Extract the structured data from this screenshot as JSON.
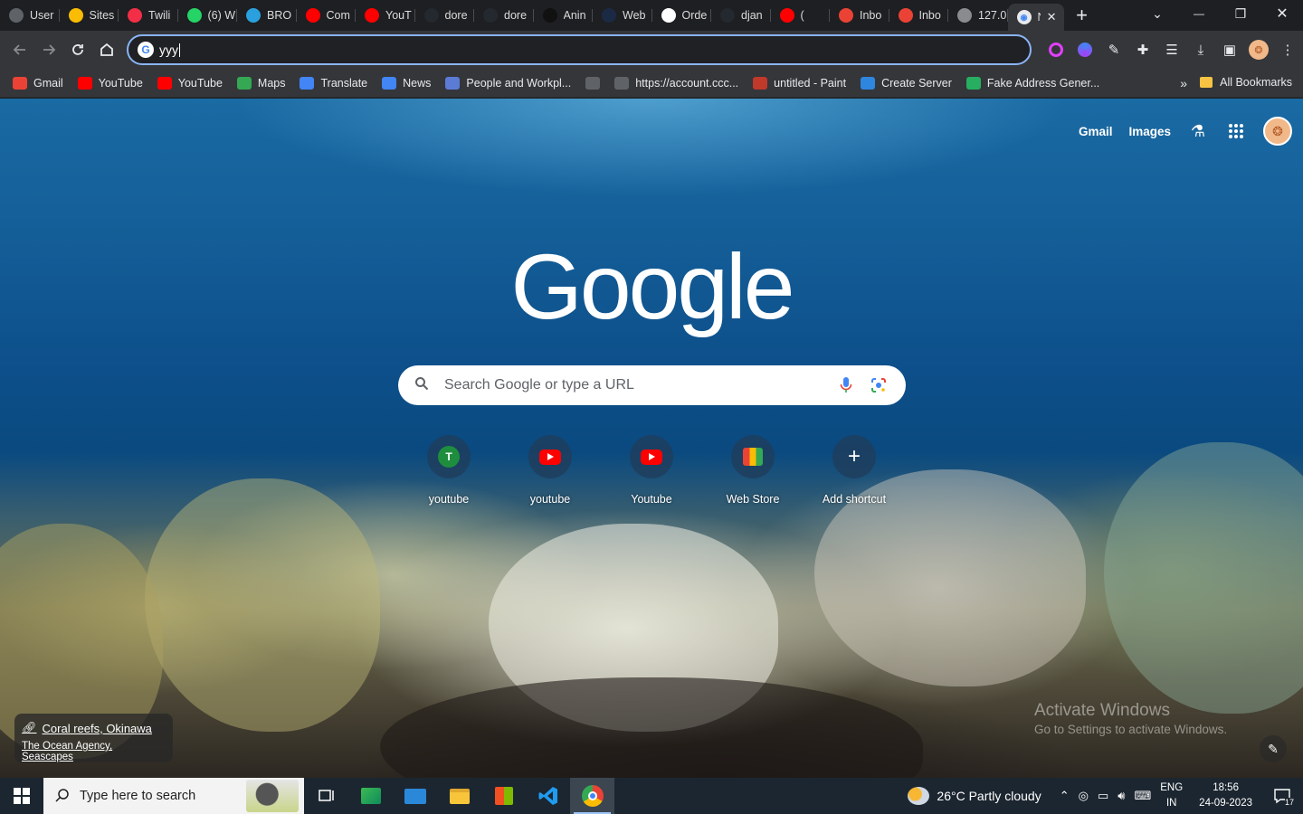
{
  "tabs": [
    {
      "title": "User",
      "icon": "openai-icon",
      "color": "#5f6368"
    },
    {
      "title": "Sites",
      "icon": "google-ads-icon",
      "color": "#fbbc04"
    },
    {
      "title": "Twili",
      "icon": "twilio-icon",
      "color": "#f22f46"
    },
    {
      "title": "(6) W",
      "icon": "whatsapp-icon",
      "color": "#25d366"
    },
    {
      "title": "BRO",
      "icon": "telegram-icon",
      "color": "#2aa1de"
    },
    {
      "title": "Com",
      "icon": "youtube-icon",
      "color": "#ff0000"
    },
    {
      "title": "YouT",
      "icon": "youtube-icon",
      "color": "#ff0000"
    },
    {
      "title": "dore",
      "icon": "github-icon",
      "color": "#24292f"
    },
    {
      "title": "dore",
      "icon": "github-icon",
      "color": "#24292f"
    },
    {
      "title": "Anin",
      "icon": "amazon-icon",
      "color": "#111111"
    },
    {
      "title": "Web",
      "icon": "webflow-icon",
      "color": "#1b2a44"
    },
    {
      "title": "Orde",
      "icon": "store-icon",
      "color": "#ffffff"
    },
    {
      "title": "djan",
      "icon": "github-icon",
      "color": "#24292f"
    },
    {
      "title": "(",
      "icon": "youtube-icon",
      "color": "#ff0000"
    },
    {
      "title": "Inbo",
      "icon": "gmail-icon",
      "color": "#ea4335"
    },
    {
      "title": "Inbo",
      "icon": "gmail-icon",
      "color": "#ea4335"
    },
    {
      "title": "127.0",
      "icon": "globe-icon",
      "color": "#8a8b8f"
    }
  ],
  "active_tab": {
    "title": "N",
    "icon": "chrome-icon",
    "close": "✕"
  },
  "new_tab_symbol": "+",
  "window_controls": {
    "tab_search": "⌄",
    "minimize": "—",
    "restore": "❐",
    "close": "✕"
  },
  "omnibox": {
    "favicon": "G",
    "value": "yyy"
  },
  "bookmarks": [
    {
      "label": "Gmail",
      "icon": "gmail-icon",
      "color": "#ea4335"
    },
    {
      "label": "YouTube",
      "icon": "youtube-icon",
      "color": "#ff0000"
    },
    {
      "label": "YouTube",
      "icon": "youtube-icon",
      "color": "#ff0000"
    },
    {
      "label": "Maps",
      "icon": "maps-icon",
      "color": "#34a853"
    },
    {
      "label": "Translate",
      "icon": "translate-icon",
      "color": "#4285f4"
    },
    {
      "label": "News",
      "icon": "news-icon",
      "color": "#4285f4"
    },
    {
      "label": "People and Workpl...",
      "icon": "shield-icon",
      "color": "#5b7bd5"
    },
    {
      "label": "",
      "icon": "globe-icon",
      "color": "#5f6368"
    },
    {
      "label": "https://account.ccc...",
      "icon": "globe-icon",
      "color": "#5f6368"
    },
    {
      "label": "untitled - Paint",
      "icon": "paint-icon",
      "color": "#c0392b"
    },
    {
      "label": "Create Server",
      "icon": "server-icon",
      "color": "#2e86de"
    },
    {
      "label": "Fake Address Gener...",
      "icon": "address-icon",
      "color": "#27ae60"
    }
  ],
  "bookmarks_more": "»",
  "all_bookmarks": "All Bookmarks",
  "ntp": {
    "top_links": [
      "Gmail",
      "Images"
    ],
    "logo": "Google",
    "search_placeholder": "Search Google or type a URL",
    "shortcuts": [
      {
        "label": "youtube",
        "icon": "letter-t-icon",
        "letter": "T"
      },
      {
        "label": "youtube",
        "icon": "youtube-icon"
      },
      {
        "label": "Youtube",
        "icon": "youtube-icon"
      },
      {
        "label": "Web Store",
        "icon": "web-store-icon"
      },
      {
        "label": "Add shortcut",
        "icon": "plus-icon"
      }
    ],
    "attribution": {
      "title": "Coral reefs, Okinawa",
      "credit": "The Ocean Agency, Seascapes"
    },
    "watermark": {
      "line1": "Activate Windows",
      "line2": "Go to Settings to activate Windows."
    }
  },
  "taskbar": {
    "search_placeholder": "Type here to search",
    "weather": "26°C  Partly cloudy",
    "lang": [
      "ENG",
      "IN"
    ],
    "time": "18:56",
    "date": "24-09-2023",
    "notifications": "17"
  }
}
